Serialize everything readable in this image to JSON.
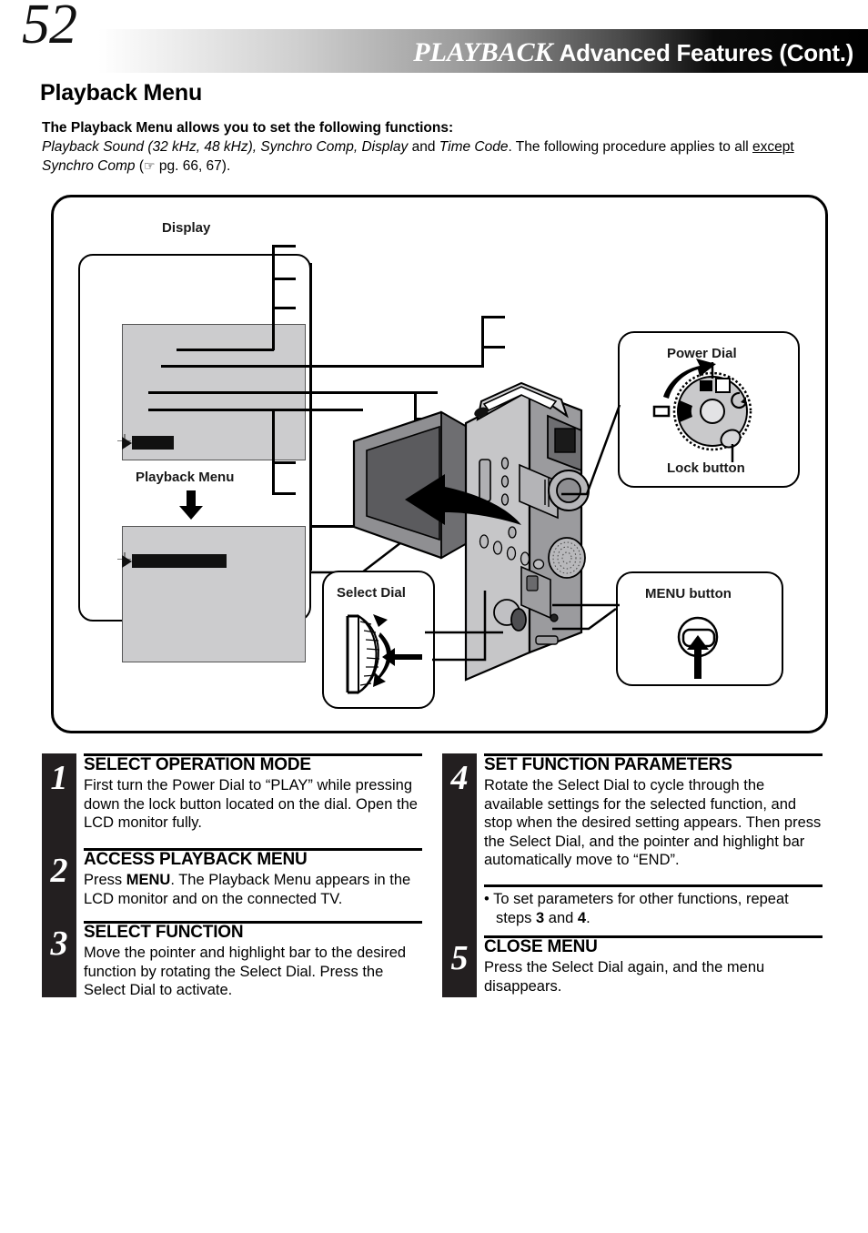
{
  "header": {
    "page_number": "52",
    "title_italic": "PLAYBACK",
    "title_bold": "Advanced Features (Cont.)"
  },
  "section": {
    "title": "Playback Menu"
  },
  "intro": {
    "lead": "The Playback Menu allows you to set the following functions:",
    "body_part1": "Playback Sound (32 kHz, 48 kHz), Synchro Comp, Display",
    "body_and": " and ",
    "body_part2": "Time Code",
    "body_part3": ". The following procedure applies to all ",
    "body_except": "except",
    "body_part4": "Synchro Comp",
    "body_paren_open": " (",
    "body_hand_icon": "☞",
    "body_pg": " pg. 66, 67).",
    "hand_icon_name": "pointing-hand-icon"
  },
  "diagram": {
    "display_label": "Display",
    "playback_menu_label": "Playback Menu",
    "power_dial_label": "Power Dial",
    "lock_button_label": "Lock button",
    "select_dial_label": "Select Dial",
    "menu_button_label": "MENU button"
  },
  "steps_left": [
    {
      "number": "1",
      "heading": "SELECT OPERATION MODE",
      "text": "First turn the Power Dial to “PLAY” while pressing down the lock button located on the dial. Open the LCD monitor fully."
    },
    {
      "number": "2",
      "heading": "ACCESS PLAYBACK MENU",
      "text_pre": "Press ",
      "text_bold": "MENU",
      "text_post": ". The Playback Menu appears in the LCD monitor and on the connected TV."
    },
    {
      "number": "3",
      "heading": "SELECT FUNCTION",
      "text": "Move the pointer and highlight bar to the desired function by rotating the Select Dial. Press the Select Dial to activate."
    }
  ],
  "steps_right": [
    {
      "number": "4",
      "heading": "SET FUNCTION PARAMETERS",
      "text": "Rotate the Select Dial to cycle through the available settings for the selected function, and stop when the desired setting appears. Then press the Select Dial, and the pointer and highlight bar automatically move to “END”."
    },
    {
      "number": "5",
      "heading": "CLOSE MENU",
      "text": "Press the Select Dial again, and the menu disappears."
    }
  ],
  "bullet": {
    "pre": "• To set parameters for other functions, repeat steps ",
    "b1": "3",
    "mid": " and ",
    "b2": "4",
    "post": "."
  },
  "colors": {
    "ink": "#000000",
    "step_bar": "#231f20",
    "lcd_gray": "#ccccce",
    "body_gray": "#b9b9bb"
  }
}
